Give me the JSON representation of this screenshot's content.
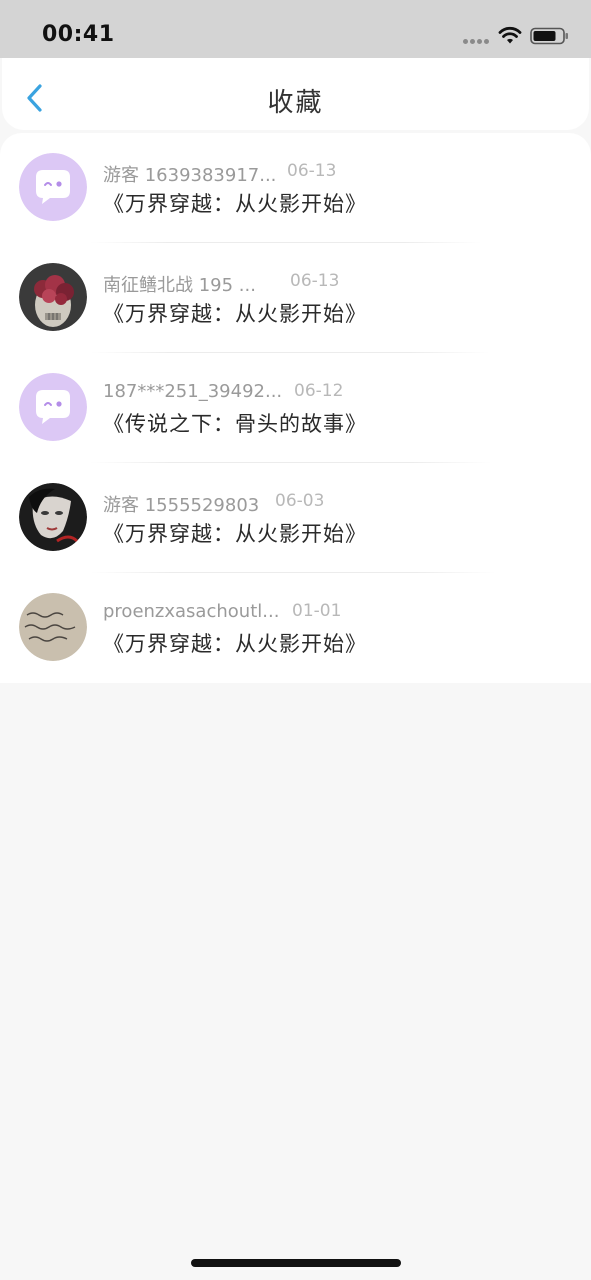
{
  "status_bar": {
    "time": "00:41",
    "icons": [
      "signal-dots-icon",
      "wifi-icon",
      "battery-icon"
    ]
  },
  "nav": {
    "back_icon": "chevron-left-icon",
    "title": "收藏"
  },
  "colors": {
    "accent": "#3aa3e0",
    "status_bar_bg": "#d4d4d4",
    "page_bg": "#f7f7f7",
    "default_avatar_bg": "#dcc8f5",
    "default_avatar_fg": "#b48de8"
  },
  "favorites": [
    {
      "avatar": "default-chat-avatar-icon",
      "user": "游客 1639383917...",
      "date": "06-13",
      "title": "《万界穿越：从火影开始》"
    },
    {
      "avatar": "skull-roses-avatar",
      "user": "南征鳝北战 195 ...",
      "date": "06-13",
      "title": "《万界穿越：从火影开始》"
    },
    {
      "avatar": "default-chat-avatar-icon",
      "user": "187***251_39492...",
      "date": "06-12",
      "title": "《传说之下：骨头的故事》"
    },
    {
      "avatar": "portrait-avatar",
      "user": "游客 1555529803",
      "date": "06-03",
      "title": "《万界穿越：从火影开始》"
    },
    {
      "avatar": "handwriting-avatar",
      "user": "proenzxasachoutl...",
      "date": "01-01",
      "title": "《万界穿越：从火影开始》"
    }
  ]
}
